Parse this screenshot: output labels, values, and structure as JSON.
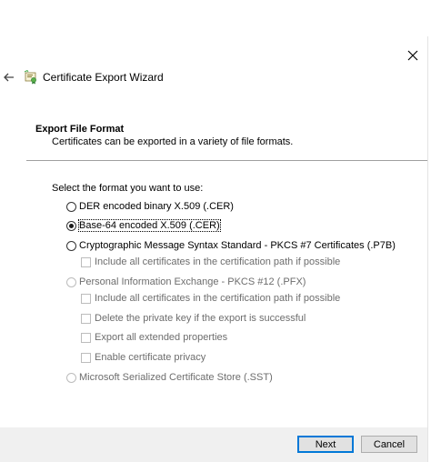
{
  "wizard": {
    "title": "Certificate Export Wizard",
    "icons": {
      "back": "back-arrow-icon",
      "close": "close-icon",
      "wizard": "certificate-wizard-icon"
    }
  },
  "section": {
    "title": "Export File Format",
    "description": "Certificates can be exported in a variety of file formats."
  },
  "format_prompt": "Select the format you want to use:",
  "options": {
    "der": {
      "label": "DER encoded binary X.509 (.CER)",
      "selected": false,
      "enabled": true
    },
    "base64": {
      "label": "Base-64 encoded X.509 (.CER)",
      "selected": true,
      "enabled": true
    },
    "pkcs7": {
      "label": "Cryptographic Message Syntax Standard - PKCS #7 Certificates (.P7B)",
      "selected": false,
      "enabled": true
    },
    "pkcs7_include": {
      "label": "Include all certificates in the certification path if possible",
      "checked": false,
      "enabled": false
    },
    "pfx": {
      "label": "Personal Information Exchange - PKCS #12 (.PFX)",
      "selected": false,
      "enabled": false
    },
    "pfx_include": {
      "label": "Include all certificates in the certification path if possible",
      "checked": false,
      "enabled": false
    },
    "pfx_delete_key": {
      "label": "Delete the private key if the export is successful",
      "checked": false,
      "enabled": false
    },
    "pfx_export_props": {
      "label": "Export all extended properties",
      "checked": false,
      "enabled": false
    },
    "pfx_privacy": {
      "label": "Enable certificate privacy",
      "checked": false,
      "enabled": false
    },
    "sst": {
      "label": "Microsoft Serialized Certificate Store (.SST)",
      "selected": false,
      "enabled": false
    }
  },
  "buttons": {
    "next": "Next",
    "cancel": "Cancel"
  },
  "colors": {
    "accent": "#0078d7",
    "footer": "#f0f0f0",
    "disabled_text": "#6d6d6d"
  }
}
